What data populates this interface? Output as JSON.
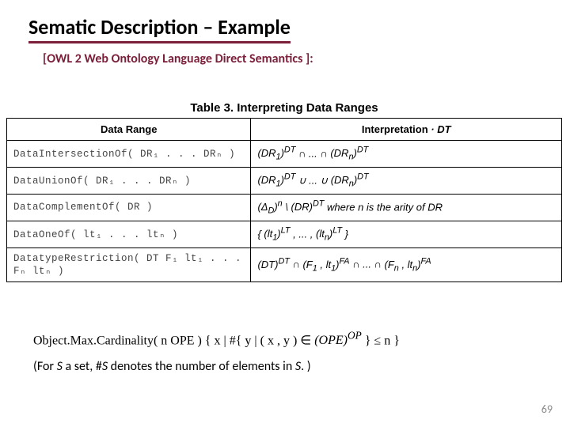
{
  "title": "Sematic Description – Example",
  "subtitle": "[OWL 2 Web Ontology Language Direct Semantics ]:",
  "table": {
    "caption": "Table 3. Interpreting Data Ranges",
    "headers": {
      "left": "Data Range",
      "right_prefix": "Interpretation",
      "right_super": "· DT"
    },
    "rows": [
      {
        "left": "DataIntersectionOf( DR₁ . . . DRₙ )",
        "right_html": "<i>(DR<sub>1</sub>)<sup>DT</sup></i> ∩ ... ∩ <i>(DR<sub>n</sub>)<sup>DT</sup></i>"
      },
      {
        "left": "DataUnionOf( DR₁ . . . DRₙ )",
        "right_html": "<i>(DR<sub>1</sub>)<sup>DT</sup></i> ∪ ... ∪ <i>(DR<sub>n</sub>)<sup>DT</sup></i>"
      },
      {
        "left": "DataComplementOf( DR )",
        "right_html": "<i>(Δ<sub>D</sub>)<sup>n</sup></i> \\ <i>(DR)<sup>DT</sup></i> where <i>n</i> is the arity of <i>DR</i>"
      },
      {
        "left": "DataOneOf( lt₁ . . . ltₙ )",
        "right_html": "{ <i>(lt<sub>1</sub>)<sup>LT</sup></i> , ... , <i>(lt<sub>n</sub>)<sup>LT</sup></i> }"
      },
      {
        "left": "DatatypeRestriction( DT F₁ lt₁ . . . Fₙ ltₙ )",
        "right_html": "<i>(DT)<sup>DT</sup></i> ∩ <i>(F<sub>1</sub> , lt<sub>1</sub>)<sup>FA</sup></i> ∩ ... ∩ <i>(F<sub>n</sub> , lt<sub>n</sub>)<sup>FA</sup></i>"
      }
    ]
  },
  "axiom_html": "Object.Max.Cardinality( n OPE ) { x | #{ y | ( x , y ) ∈ <i>(OPE)<sup>OP</sup></i> } ≤ n }",
  "note_html": "(For <i>S</i> a set, #<i>S</i> denotes the number of elements in <i>S</i>. )",
  "slidenum": "69",
  "chart_data": {
    "type": "table",
    "title": "Table 3. Interpreting Data Ranges",
    "columns": [
      "Data Range",
      "Interpretation · DT"
    ],
    "rows": [
      [
        "DataIntersectionOf( DR1 ... DRn )",
        "(DR1)^DT ∩ ... ∩ (DRn)^DT"
      ],
      [
        "DataUnionOf( DR1 ... DRn )",
        "(DR1)^DT ∪ ... ∪ (DRn)^DT"
      ],
      [
        "DataComplementOf( DR )",
        "(ΔD)^n \\ (DR)^DT where n is the arity of DR"
      ],
      [
        "DataOneOf( lt1 ... ltn )",
        "{ (lt1)^LT , ... , (ltn)^LT }"
      ],
      [
        "DatatypeRestriction( DT F1 lt1 ... Fn ltn )",
        "(DT)^DT ∩ (F1, lt1)^FA ∩ ... ∩ (Fn, ltn)^FA"
      ]
    ]
  }
}
